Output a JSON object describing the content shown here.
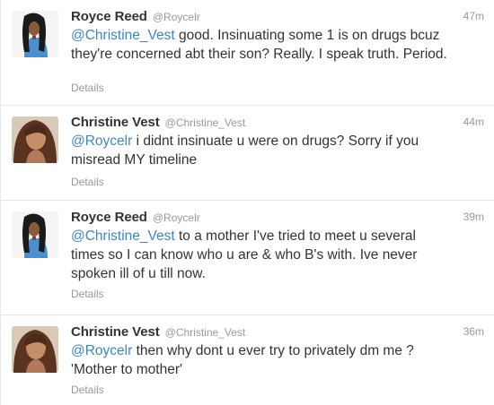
{
  "tweets": [
    {
      "fullname": "Royce Reed",
      "username": "@Roycelr",
      "time": "47m",
      "mention": "@Christine_Vest",
      "text": " good. Insinuating some 1 is on drugs bcuz they're concerned abt their son? Really. I speak truth. Period.",
      "details": "Details",
      "avatar": "royce-avatar"
    },
    {
      "fullname": "Christine Vest",
      "username": "@Christine_Vest",
      "time": "44m",
      "mention": "@Roycelr",
      "text": " i didnt insinuate u were on drugs? Sorry if you misread MY timeline",
      "details": "Details",
      "avatar": "christine-avatar"
    },
    {
      "fullname": "Royce Reed",
      "username": "@Roycelr",
      "time": "39m",
      "mention": "@Christine_Vest",
      "text": " to a mother I've tried to meet u several times so I can know who u are & who B's with. Ive never spoken ill of u till now.",
      "details": "Details",
      "avatar": "royce-avatar"
    },
    {
      "fullname": "Christine Vest",
      "username": "@Christine_Vest",
      "time": "36m",
      "mention": "@Roycelr",
      "text": " then why dont u ever try to privately dm me ? 'Mother to mother'",
      "details": "Details",
      "avatar": "christine-avatar"
    }
  ],
  "colors": {
    "mention": "#3b88c3",
    "meta": "#999999",
    "text": "#333333"
  }
}
